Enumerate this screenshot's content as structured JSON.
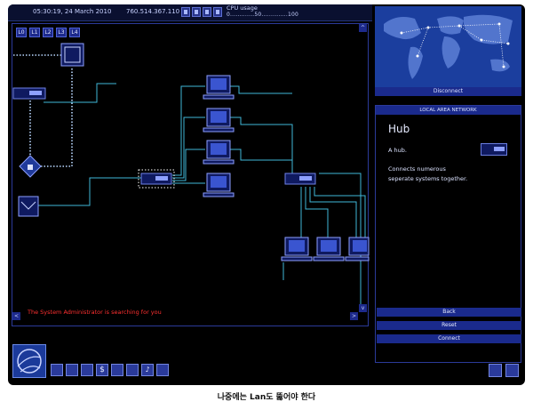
{
  "topbar": {
    "datetime": "05:30:19, 24 March 2010",
    "ip": "760.514.367.110",
    "cpu_label": "CPU usage",
    "cpu_scale": "0.............50..............100",
    "control_buttons": [
      "pause-icon",
      "play-icon",
      "fast-forward-icon",
      "fastest-icon"
    ]
  },
  "network": {
    "levels": [
      "L0",
      "L1",
      "L2",
      "L3",
      "L4"
    ],
    "status_message": "The System Administrator is searching for you",
    "scroll": {
      "up": "^",
      "down": "v",
      "left": "<",
      "right": ">"
    },
    "colors": {
      "link": "#3fb7d9",
      "trace": "#b9d7ff",
      "device": "#6f82e8",
      "alert": "#ff3030"
    }
  },
  "world_map": {
    "disconnect_label": "Disconnect"
  },
  "info_panel": {
    "header": "LOCAL AREA NETWORK",
    "title": "Hub",
    "short_desc": "A hub.",
    "long_desc": "Connects numerous seperate systems together.",
    "buttons": {
      "back": "Back",
      "reset": "Reset",
      "connect": "Connect"
    }
  },
  "bottom_toolbar": {
    "logo": "globe-logo-icon",
    "icons": [
      "terminal-icon",
      "software-icon",
      "hardware-icon",
      "finance-icon",
      "email-icon",
      "memory-icon",
      "music-icon",
      "lan-icon"
    ],
    "right_icons": [
      "send-icon",
      "folder-icon"
    ]
  },
  "caption": "나중에는 Lan도 뚫어야 한다"
}
